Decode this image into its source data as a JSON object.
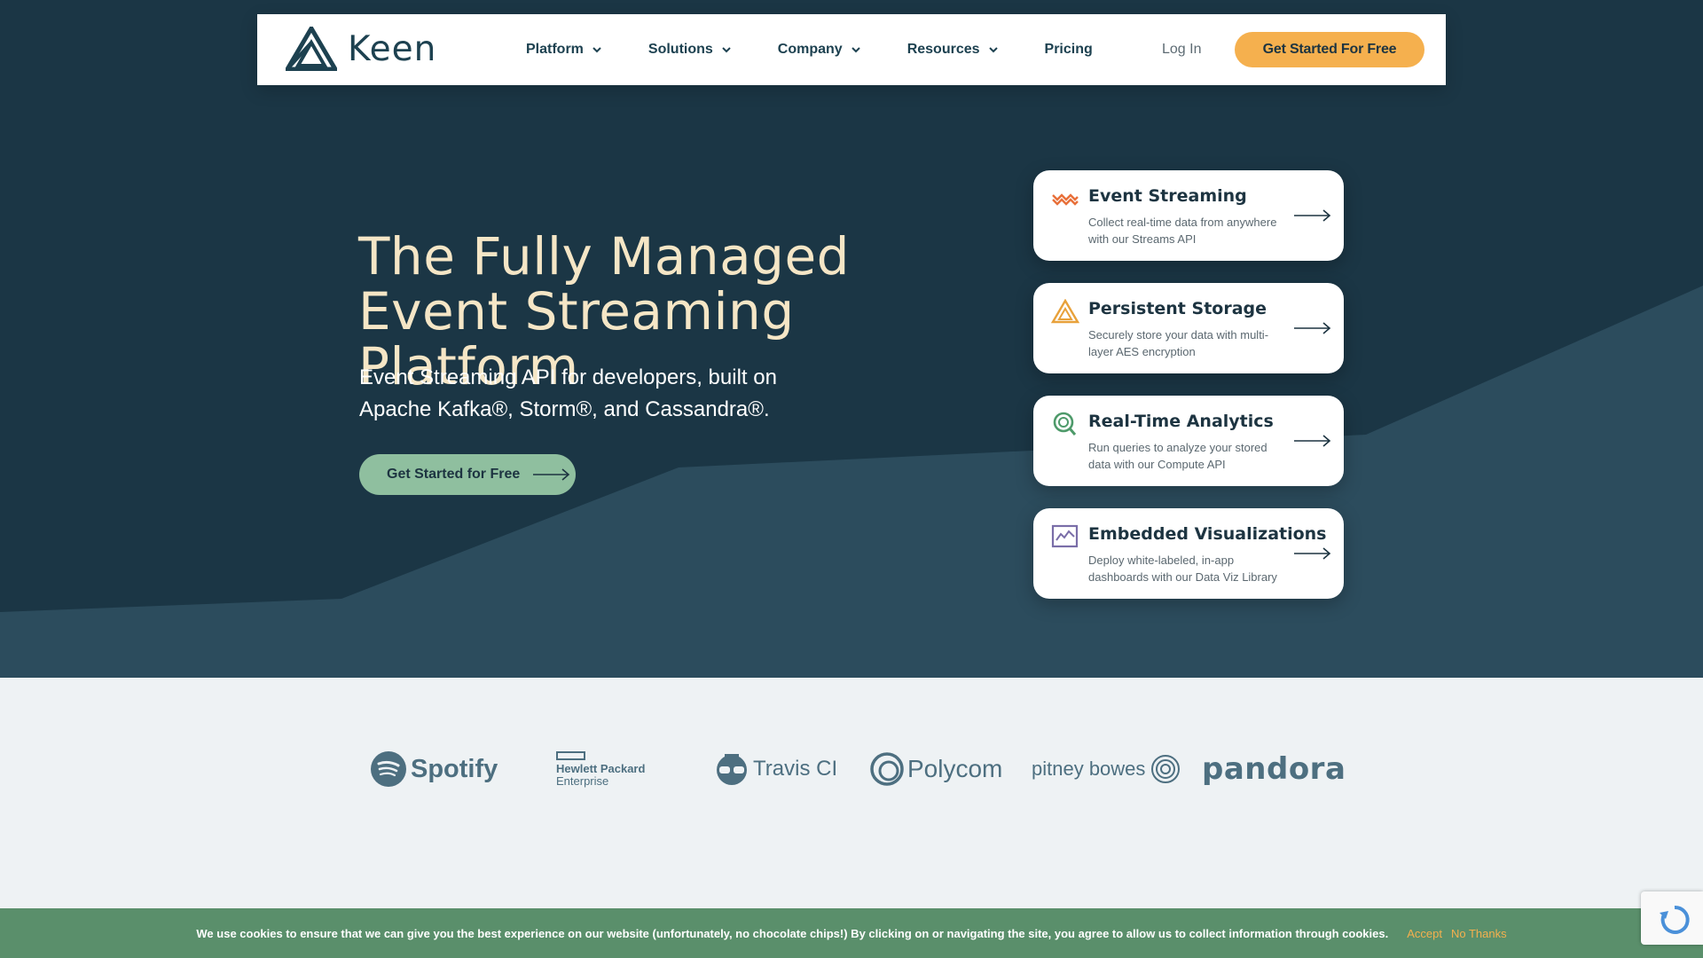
{
  "brand": {
    "name": "Keen"
  },
  "nav": {
    "items": [
      {
        "label": "Platform",
        "has_dropdown": true
      },
      {
        "label": "Solutions",
        "has_dropdown": true
      },
      {
        "label": "Company",
        "has_dropdown": true
      },
      {
        "label": "Resources",
        "has_dropdown": true
      },
      {
        "label": "Pricing",
        "has_dropdown": false
      }
    ],
    "login_label": "Log In",
    "cta_label": "Get Started For Free"
  },
  "hero": {
    "title": "The Fully Managed Event Streaming Platform",
    "subtitle": "Event Streaming API for developers, built on Apache Kafka®, Storm®, and Cassandra®.",
    "cta_label": "Get Started for Free"
  },
  "features": [
    {
      "title": "Event Streaming",
      "description": "Collect real-time data from anywhere with our Streams API",
      "icon": "wave-icon",
      "color": "#e8703a"
    },
    {
      "title": "Persistent Storage",
      "description": "Securely store your data with multi-layer AES encryption",
      "icon": "triangle-icon",
      "color": "#e8a13a"
    },
    {
      "title": "Real-Time Analytics",
      "description": "Run queries to analyze your stored data with our Compute API",
      "icon": "magnifier-icon",
      "color": "#4e9a6a"
    },
    {
      "title": "Embedded Visualizations",
      "description": "Deploy white-labeled, in-app dashboards with our Data Viz Library",
      "icon": "chart-icon",
      "color": "#7a6ea8"
    }
  ],
  "customers": {
    "spotify": "Spotify",
    "hpe_line1": "Hewlett Packard",
    "hpe_line2": "Enterprise",
    "travis": "Travis CI",
    "polycom": "Polycom",
    "pitney": "pitney bowes",
    "pandora": "pandora"
  },
  "cookie": {
    "text": "We use cookies to ensure that we can give you the best experience on our website (unfortunately, no chocolate chips!) By clicking on or navigating the site, you agree to allow us to collect information through cookies.",
    "accept_label": "Accept",
    "decline_label": "No Thanks"
  },
  "colors": {
    "hero_bg": "#1b3645",
    "accent_orange": "#f5b04e",
    "accent_green": "#8fbf9f",
    "cookie_bg": "#5a8f6b"
  }
}
